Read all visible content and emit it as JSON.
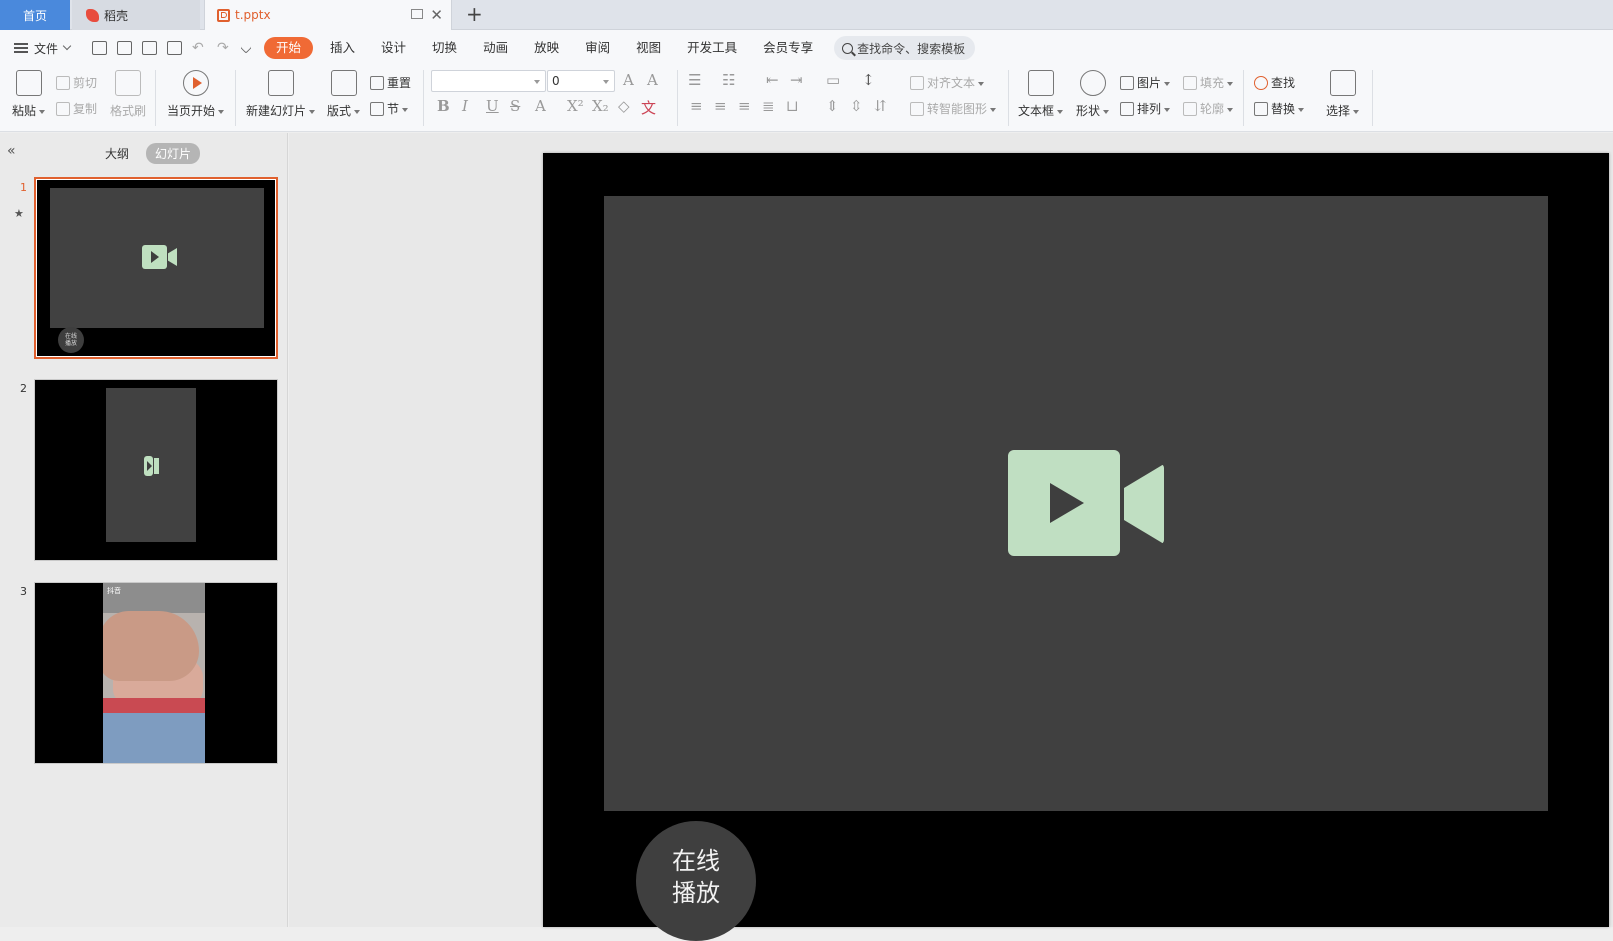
{
  "tabs": {
    "home": "首页",
    "daoke": "稻壳",
    "file": "t.pptx"
  },
  "menu": {
    "file_label": "文件",
    "tabs": [
      "开始",
      "插入",
      "设计",
      "切换",
      "动画",
      "放映",
      "审阅",
      "视图",
      "开发工具",
      "会员专享"
    ],
    "active_tab": "开始",
    "search_placeholder": "查找命令、搜索模板"
  },
  "ribbon": {
    "paste": "粘贴",
    "cut": "剪切",
    "copy": "复制",
    "format_painter": "格式刷",
    "from_current": "当页开始",
    "new_slide": "新建幻灯片",
    "layout": "版式",
    "reset": "重置",
    "section": "节",
    "font_size": "0",
    "align_text": "对齐文本",
    "smart_shape": "转智能图形",
    "text_box": "文本框",
    "shape": "形状",
    "picture": "图片",
    "fill": "填充",
    "arrange": "排列",
    "outline": "轮廓",
    "find": "查找",
    "replace": "替换",
    "select": "选择"
  },
  "left_panel": {
    "outline_tab": "大纲",
    "slides_tab": "幻灯片",
    "slides": [
      {
        "num": "1",
        "online_label": "在线\n播放"
      },
      {
        "num": "2"
      },
      {
        "num": "3",
        "tag": "抖音"
      }
    ]
  },
  "slide": {
    "online_play_line1": "在线",
    "online_play_line2": "播放"
  },
  "colors": {
    "accent": "#f06a35",
    "home_tab": "#4a89dc",
    "video_bg": "#404040",
    "camera_icon": "#c0dfc2"
  }
}
